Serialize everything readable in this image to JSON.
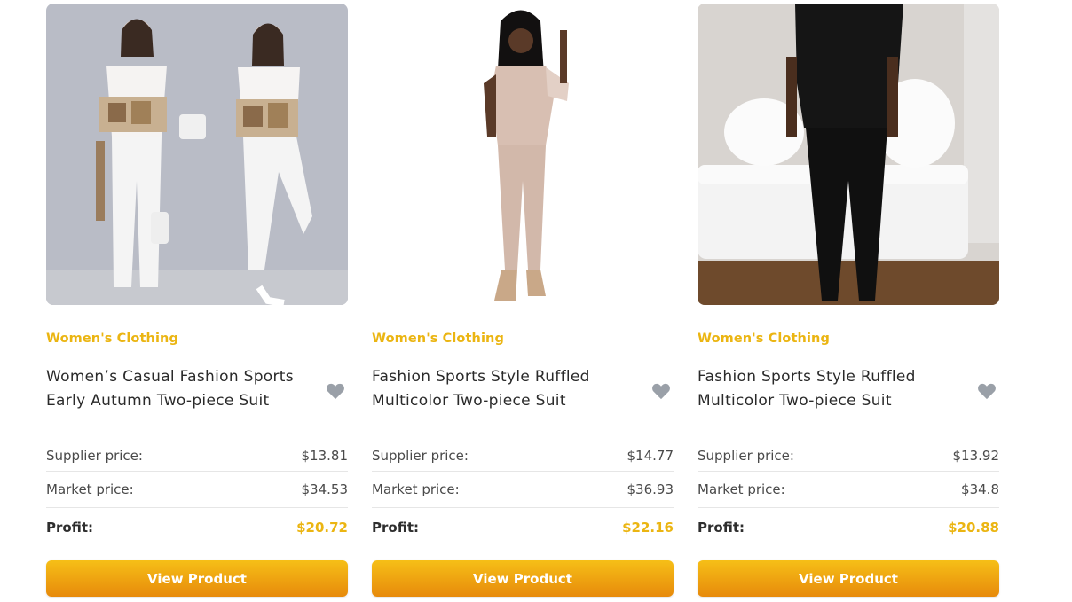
{
  "accent_color": "#ebb512",
  "button_gradient": [
    "#f6bf17",
    "#e78a0b"
  ],
  "products": [
    {
      "image": "two women in white printed casual sports suits",
      "category": "Women's Clothing",
      "title": "Women’s Casual Fashion Sports Early Autumn Two-piece Suit",
      "supplier_label": "Supplier price:",
      "supplier_price": "$13.81",
      "market_label": "Market price:",
      "market_price": "$34.53",
      "profit_label": "Profit:",
      "profit": "$20.72",
      "button_label": "View Product",
      "favorite_icon": "heart-icon"
    },
    {
      "image": "woman in beige ruffled two-piece suit",
      "category": "Women's Clothing",
      "title": "Fashion Sports Style Ruffled Multicolor Two-piece Suit",
      "supplier_label": "Supplier price:",
      "supplier_price": "$14.77",
      "market_label": "Market price:",
      "market_price": "$36.93",
      "profit_label": "Profit:",
      "profit": "$22.16",
      "button_label": "View Product",
      "favorite_icon": "heart-icon"
    },
    {
      "image": "woman in black ruffled two-piece suit by white sofa",
      "category": "Women's Clothing",
      "title": "Fashion Sports Style Ruffled Multicolor Two-piece Suit",
      "supplier_label": "Supplier price:",
      "supplier_price": "$13.92",
      "market_label": "Market price:",
      "market_price": "$34.8",
      "profit_label": "Profit:",
      "profit": "$20.88",
      "button_label": "View Product",
      "favorite_icon": "heart-icon"
    }
  ]
}
